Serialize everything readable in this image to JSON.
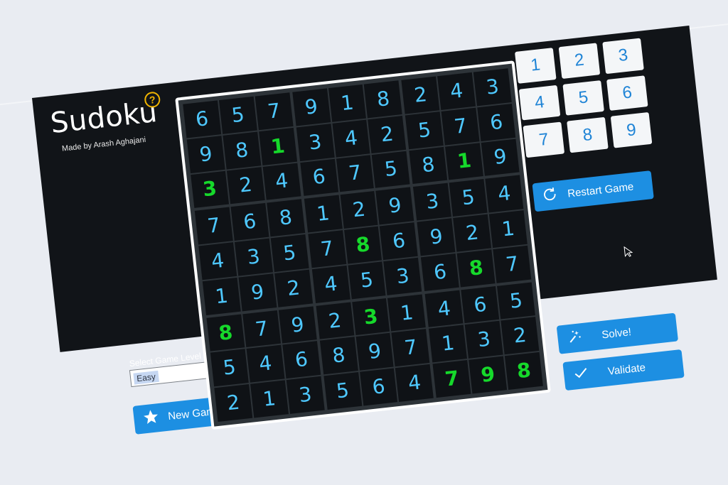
{
  "app": {
    "title": "Sudoku",
    "subtitle": "Made by Arash Aghajani"
  },
  "level": {
    "label": "Select Game Level :",
    "value": "Easy"
  },
  "buttons": {
    "new_game": "New Game",
    "restart_game": "Restart Game",
    "solve": "Solve!",
    "validate": "Validate"
  },
  "keypad": [
    "1",
    "2",
    "3",
    "4",
    "5",
    "6",
    "7",
    "8",
    "9"
  ],
  "board": [
    [
      6,
      5,
      7,
      9,
      1,
      8,
      2,
      4,
      3
    ],
    [
      9,
      8,
      1,
      3,
      4,
      2,
      5,
      7,
      6
    ],
    [
      3,
      2,
      4,
      6,
      7,
      5,
      8,
      1,
      9
    ],
    [
      7,
      6,
      8,
      1,
      2,
      9,
      3,
      5,
      4
    ],
    [
      4,
      3,
      5,
      7,
      8,
      6,
      9,
      2,
      1
    ],
    [
      1,
      9,
      2,
      4,
      5,
      3,
      6,
      8,
      7
    ],
    [
      8,
      7,
      9,
      2,
      3,
      1,
      4,
      6,
      5
    ],
    [
      5,
      4,
      6,
      8,
      9,
      7,
      1,
      3,
      2
    ],
    [
      2,
      1,
      3,
      5,
      6,
      4,
      7,
      9,
      8
    ]
  ],
  "fixed_cells": [
    [
      1,
      2
    ],
    [
      2,
      0
    ],
    [
      2,
      7
    ],
    [
      4,
      4
    ],
    [
      5,
      7
    ],
    [
      6,
      0
    ],
    [
      6,
      4
    ],
    [
      8,
      6
    ],
    [
      8,
      7
    ],
    [
      8,
      8
    ]
  ],
  "colors": {
    "background": "#111418",
    "accent": "#1d8fe2",
    "digit_user": "#4ec8ff",
    "digit_fixed": "#16d92b",
    "keypad_text": "#1f84d6",
    "help_icon": "#f0b400"
  }
}
